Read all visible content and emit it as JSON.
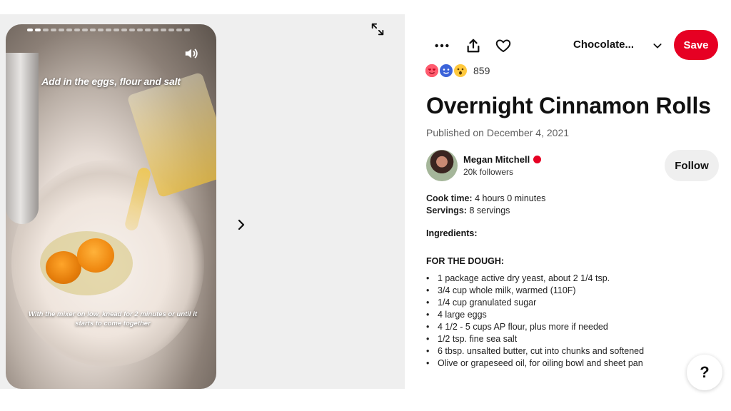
{
  "story": {
    "caption_top": "Add in the eggs, flour and salt",
    "caption_bottom": "With the mixer on low, knead for 2 minutes or until it starts to come together",
    "progress_segments": 21,
    "active_segment": 2
  },
  "toolbar": {
    "board_name": "Chocolate...",
    "save_label": "Save"
  },
  "reactions": {
    "count": "859",
    "icons": [
      "heart-eyes-icon",
      "blue-face-icon",
      "wow-face-icon"
    ]
  },
  "pin": {
    "title": "Overnight Cinnamon Rolls",
    "published": "Published on December 4, 2021"
  },
  "creator": {
    "name": "Megan Mitchell",
    "followers": "20k followers",
    "follow_label": "Follow"
  },
  "recipe": {
    "cook_time_label": "Cook time:",
    "cook_time_value": "4 hours 0 minutes",
    "servings_label": "Servings:",
    "servings_value": "8 servings",
    "ingredients_label": "Ingredients:",
    "section_label": "FOR THE DOUGH:",
    "items": [
      "1 package active dry yeast, about 2 1/4 tsp.",
      "3/4 cup whole milk, warmed (110F)",
      "1/4 cup granulated sugar",
      "4 large eggs",
      "4 1/2 - 5 cups AP flour, plus more if needed",
      "1/2 tsp. fine sea salt",
      "6 tbsp. unsalted butter, cut into chunks and softened",
      "Olive or grapeseed oil, for oiling bowl and sheet pan"
    ]
  },
  "help_label": "?",
  "colors": {
    "accent": "#e60023",
    "panel_bg": "#efefef"
  }
}
